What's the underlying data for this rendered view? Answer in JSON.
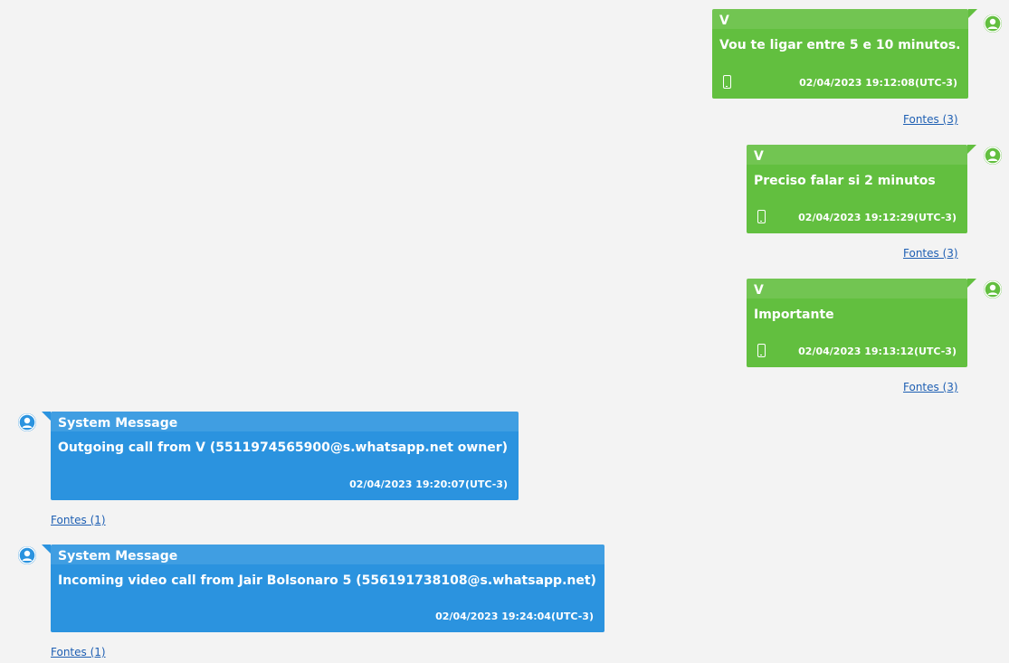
{
  "messages": [
    {
      "sender": "V",
      "text": "Vou te ligar entre 5 e 10 minutos.",
      "timestamp": "02/04/2023 19:12:08(UTC-3)",
      "sources": "Fontes (3)"
    },
    {
      "sender": "V",
      "text": "Preciso falar si 2 minutos",
      "timestamp": "02/04/2023 19:12:29(UTC-3)",
      "sources": "Fontes (3)"
    },
    {
      "sender": "V",
      "text": "Importante",
      "timestamp": "02/04/2023 19:13:12(UTC-3)",
      "sources": "Fontes (3)"
    },
    {
      "sender": "System Message",
      "text": "Outgoing call from V (5511974565900@s.whatsapp.net owner)",
      "timestamp": "02/04/2023 19:20:07(UTC-3)",
      "sources": "Fontes (1)"
    },
    {
      "sender": "System Message",
      "text": "Incoming video call from Jair Bolsonaro 5 (556191738108@s.whatsapp.net)",
      "timestamp": "02/04/2023 19:24:04(UTC-3)",
      "sources": "Fontes (1)"
    }
  ],
  "colors": {
    "outgoing_bubble": "#62bf3f",
    "system_bubble": "#2b93df",
    "background": "#f3f3f3",
    "link": "#1e5fb3"
  },
  "icons": {
    "avatar": "user-avatar-icon",
    "device": "phone-icon"
  }
}
